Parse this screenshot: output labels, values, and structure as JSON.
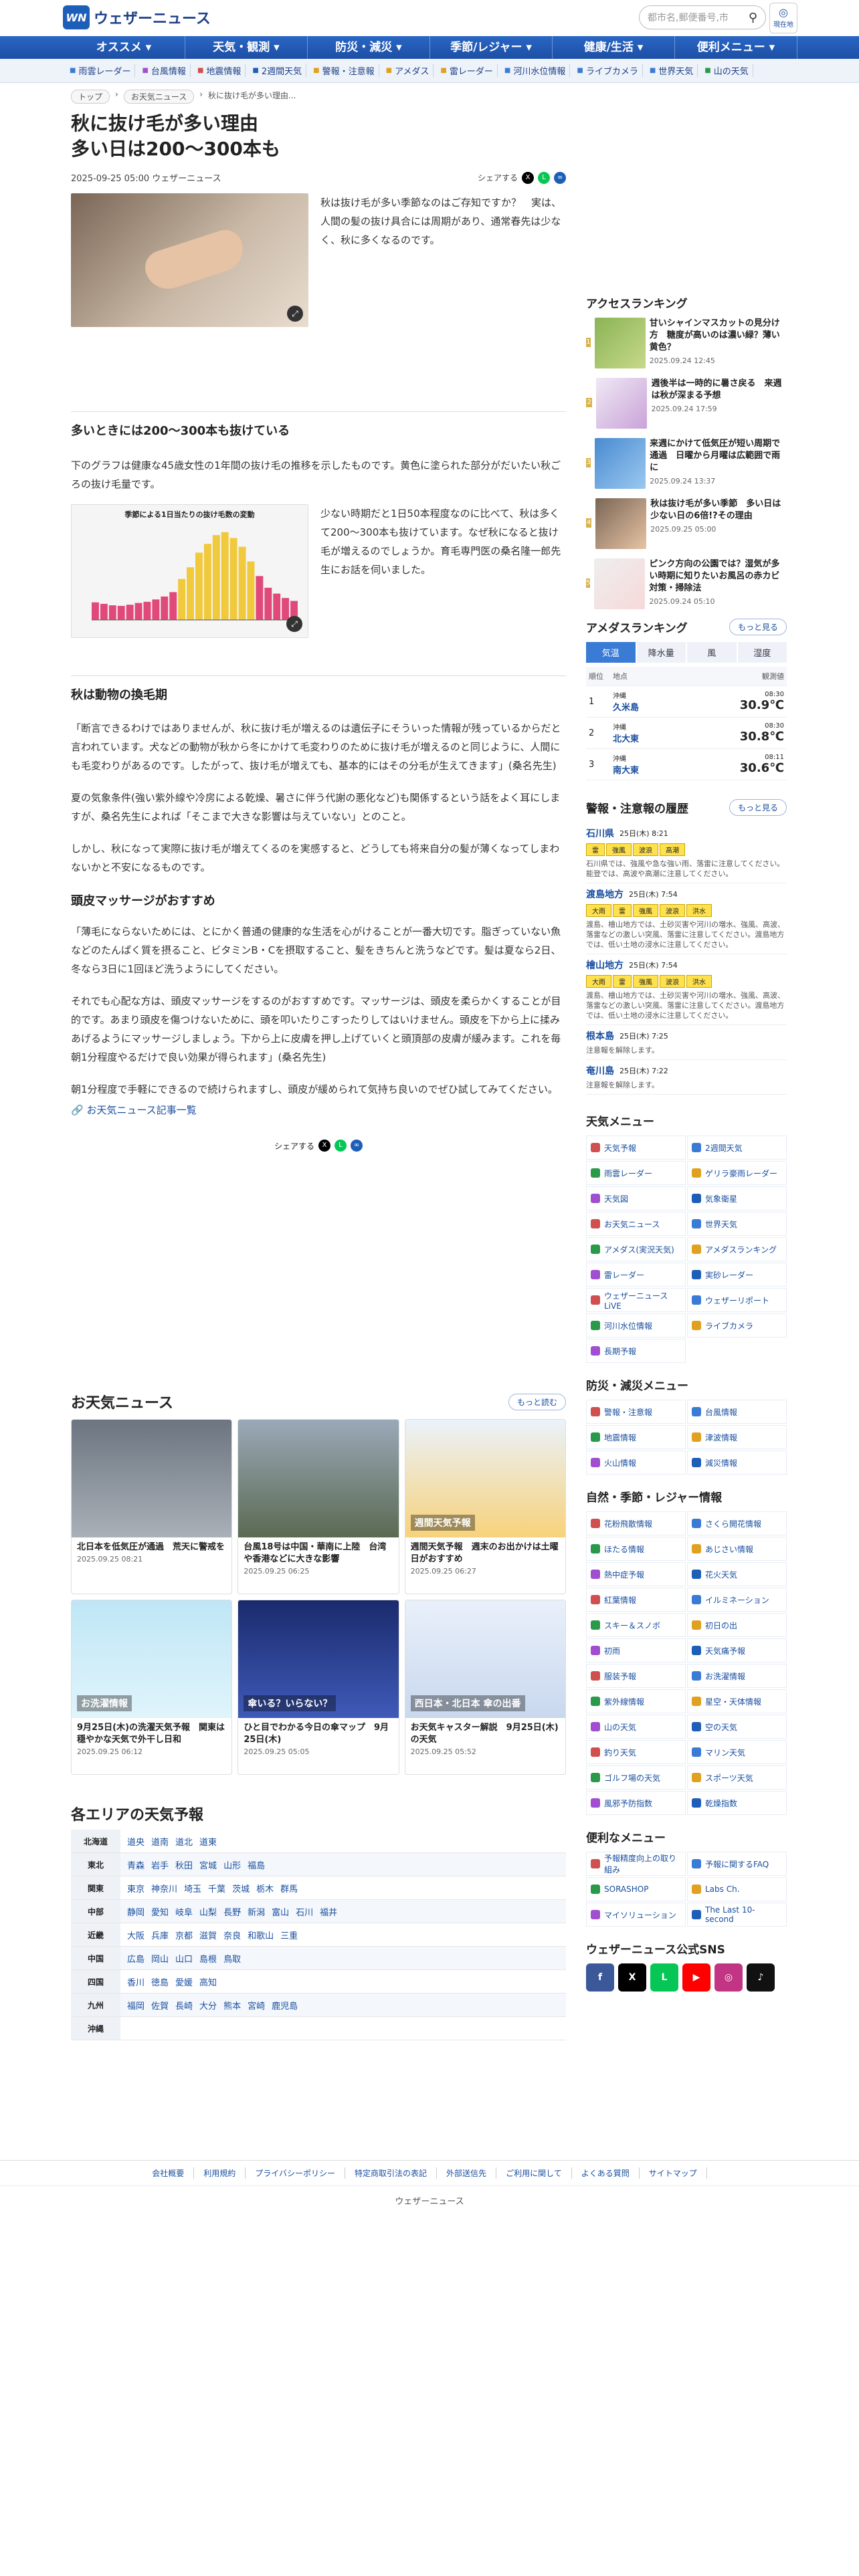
{
  "header": {
    "logo_mark": "WN",
    "logo_text": "ウェザーニュース",
    "search_placeholder": "都市名,郵便番号,市",
    "loc_label": "現在地"
  },
  "nav": [
    "オススメ",
    "天気・観測",
    "防災・減災",
    "季節/レジャー",
    "健康/生活",
    "便利メニュー"
  ],
  "subnav": [
    "雨雲レーダー",
    "台風情報",
    "地震情報",
    "2週間天気",
    "警報・注意報",
    "アメダス",
    "雷レーダー",
    "河川水位情報",
    "ライブカメラ",
    "世界天気",
    "山の天気"
  ],
  "breadcrumb": [
    "トップ",
    "お天気ニュース",
    "秋に抜け毛が多い理由..."
  ],
  "article": {
    "title_line1": "秋に抜け毛が多い理由",
    "title_line2": "多い日は200〜300本も",
    "date": "2025-09-25 05:00 ウェザーニュース",
    "share_label": "シェアする",
    "intro": "秋は抜け毛が多い季節なのはご存知ですか？　実は、人間の髪の抜け具合には周期があり、通常春先は少なく、秋に多くなるのです。",
    "h1": "多いときには200〜300本も抜けている",
    "p1": "下のグラフは健康な45歳女性の1年間の抜け毛の推移を示したものです。黄色に塗られた部分がだいたい秋ごろの抜け毛量です。",
    "chart_title": "季節による1日当たりの抜け毛数の変動",
    "p2": "少ない時期だと1日50本程度なのに比べて、秋は多くて200〜300本も抜けています。なぜ秋になると抜け毛が増えるのでしょうか。育毛専門医の桑名隆一郎先生にお話を伺いました。",
    "h2": "秋は動物の換毛期",
    "p3": "「断言できるわけではありませんが、秋に抜け毛が増えるのは遺伝子にそういった情報が残っているからだと言われています。犬などの動物が秋から冬にかけて毛変わりのために抜け毛が増えるのと同じように、人間にも毛変わりがあるのです。したがって、抜け毛が増えても、基本的にはその分毛が生えてきます」(桑名先生)",
    "p4": "夏の気象条件(強い紫外線や冷房による乾燥、暑さに伴う代謝の悪化など)も関係するという話をよく耳にしますが、桑名先生によれば「そこまで大きな影響は与えていない」とのこと。",
    "p5": "しかし、秋になって実際に抜け毛が増えてくるのを実感すると、どうしても将来自分の髪が薄くなってしまわないかと不安になるものです。",
    "h3": "頭皮マッサージがおすすめ",
    "p6": "「薄毛にならないためには、とにかく普通の健康的な生活を心がけることが一番大切です。脂ぎっていない魚などのたんぱく質を摂ること、ビタミンB・Cを摂取すること、髪をきちんと洗うなどです。髪は夏なら2日、冬なら3日に1回ほど洗うようにしてください。",
    "p7": "それでも心配な方は、頭皮マッサージをするのがおすすめです。マッサージは、頭皮を柔らかくすることが目的です。あまり頭皮を傷つけないために、頭を叩いたりこすったりしてはいけません。頭皮を下から上に揉みあげるようにマッサージしましょう。下から上に皮膚を押し上げていくと頭頂部の皮膚が緩みます。これを毎朝1分程度やるだけで良い効果が得られます」(桑名先生)",
    "p8": "朝1分程度で手軽にできるので続けられますし、頭皮が緩められて気持ち良いのでぜひ試してみてください。",
    "link": "お天気ニュース記事一覧"
  },
  "ranking": {
    "title": "アクセスランキング",
    "items": [
      {
        "title": "甘いシャインマスカットの見分け方　糖度が高いのは濃い緑？薄い黄色？",
        "date": "2025.09.24 12:45"
      },
      {
        "title": "週後半は一時的に暑さ戻る　来週は秋が深まる予想",
        "date": "2025.09.24 17:59"
      },
      {
        "title": "来週にかけて低気圧が短い周期で通過　日曜から月曜は広範囲で雨に",
        "date": "2025.09.24 13:37"
      },
      {
        "title": "秋は抜け毛が多い季節　多い日は少ない日の6倍!?その理由",
        "date": "2025.09.25 05:00"
      },
      {
        "title": "ピンク方向の公園では？湿気が多い時期に知りたいお風呂の赤カビ対策・掃除法",
        "date": "2025.09.24 05:10"
      }
    ]
  },
  "amedas": {
    "title": "アメダスランキング",
    "more": "もっと見る",
    "tabs": [
      "気温",
      "降水量",
      "風",
      "湿度"
    ],
    "headers": [
      "順位",
      "地点",
      "観測値"
    ],
    "rows": [
      {
        "rank": "1",
        "pref": "沖縄",
        "name": "久米島",
        "time": "08:30",
        "val": "30.9℃"
      },
      {
        "rank": "2",
        "pref": "沖縄",
        "name": "北大東",
        "time": "08:30",
        "val": "30.8℃"
      },
      {
        "rank": "3",
        "pref": "沖縄",
        "name": "南大東",
        "time": "08:11",
        "val": "30.6℃"
      }
    ]
  },
  "warnings": {
    "title": "警報・注意報の履歴",
    "more": "もっと見る",
    "items": [
      {
        "area": "石川県",
        "time": "25日(木) 8:21",
        "badges": [
          "雷",
          "強風",
          "波浪",
          "高潮"
        ],
        "text": "石川県では、強風や急な強い雨、落雷に注意してください。能登では、高波や高潮に注意してください。"
      },
      {
        "area": "渡島地方",
        "time": "25日(木) 7:54",
        "badges": [
          "大雨",
          "雷",
          "強風",
          "波浪",
          "洪水"
        ],
        "text": "渡島、檜山地方では、土砂災害や河川の増水、強風、高波、落雷などの激しい突風、落雷に注意してください。渡島地方では、低い土地の浸水に注意してください。"
      },
      {
        "area": "檜山地方",
        "time": "25日(木) 7:54",
        "badges": [
          "大雨",
          "雷",
          "強風",
          "波浪",
          "洪水"
        ],
        "text": "渡島、檜山地方では、土砂災害や河川の増水、強風、高波、落雷などの激しい突風、落雷に注意してください。渡島地方では、低い土地の浸水に注意してください。"
      },
      {
        "area": "根本島",
        "time": "25日(木) 7:25",
        "badges": [],
        "text": "注意報を解除します。"
      },
      {
        "area": "奄川島",
        "time": "25日(木) 7:22",
        "badges": [],
        "text": "注意報を解除します。"
      }
    ]
  },
  "weather_menu": {
    "title": "天気メニュー",
    "items": [
      "天気予報",
      "2週間天気",
      "雨雲レーダー",
      "ゲリラ豪雨レーダー",
      "天気図",
      "気象衛星",
      "お天気ニュース",
      "世界天気",
      "アメダス(実況天気)",
      "アメダスランキング",
      "雷レーダー",
      "実砂レーダー",
      "ウェザーニュースLiVE",
      "ウェザーリポート",
      "河川水位情報",
      "ライブカメラ",
      "長期予報"
    ]
  },
  "disaster_menu": {
    "title": "防災・減災メニュー",
    "items": [
      "警報・注意報",
      "台風情報",
      "地震情報",
      "津波情報",
      "火山情報",
      "減災情報"
    ]
  },
  "season_menu": {
    "title": "自然・季節・レジャー情報",
    "items": [
      "花粉飛散情報",
      "さくら開花情報",
      "ほたる情報",
      "あじさい情報",
      "熱中症予報",
      "花火天気",
      "紅葉情報",
      "イルミネーション",
      "スキー＆スノボ",
      "初日の出",
      "初雨",
      "天気痛予報",
      "服装予報",
      "お洗濯情報",
      "紫外線情報",
      "星空・天体情報",
      "山の天気",
      "空の天気",
      "釣り天気",
      "マリン天気",
      "ゴルフ場の天気",
      "スポーツ天気",
      "風邪予防指数",
      "乾燥指数"
    ]
  },
  "useful_menu": {
    "title": "便利なメニュー",
    "items": [
      "予報精度向上の取り組み",
      "予報に関するFAQ",
      "SORASHOP",
      "Labs Ch.",
      "マイソリューション",
      "The Last 10-second"
    ]
  },
  "sns": {
    "title": "ウェザーニュース公式SNS",
    "items": [
      "f",
      "X",
      "L",
      "▶",
      "◎",
      "♪"
    ],
    "colors": [
      "#3b5998",
      "#000000",
      "#06c755",
      "#ff0000",
      "#c13584",
      "#111111"
    ]
  },
  "news": {
    "title": "お天気ニュース",
    "more": "もっと読む",
    "items": [
      {
        "title": "北日本を低気圧が通過　荒天に警戒を",
        "date": "2025.09.25 08:21"
      },
      {
        "title": "台風18号は中国・華南に上陸　台湾や香港などに大きな影響",
        "date": "2025.09.25 06:25"
      },
      {
        "title": "週間天気予報　週末のお出かけは土曜日がおすすめ",
        "date": "2025.09.25 06:27"
      },
      {
        "title": "9月25日(木)の洗濯天気予報　関東は穏やかな天気で外干し日和",
        "date": "2025.09.25 06:12"
      },
      {
        "title": "ひと目でわかる今日の傘マップ　9月25日(木)",
        "date": "2025.09.25 05:05"
      },
      {
        "title": "お天気キャスター解説　9月25日(木)の天気",
        "date": "2025.09.25 05:52"
      }
    ],
    "img_texts": [
      "",
      "",
      "週間天気予報",
      "お洗濯情報",
      "傘いる？いらない？",
      "西日本・北日本 傘の出番"
    ]
  },
  "areas": {
    "title": "各エリアの天気予報",
    "rows": [
      {
        "name": "北海道",
        "links": [
          "道央",
          "道南",
          "道北",
          "道東"
        ]
      },
      {
        "name": "東北",
        "links": [
          "青森",
          "岩手",
          "秋田",
          "宮城",
          "山形",
          "福島"
        ]
      },
      {
        "name": "関東",
        "links": [
          "東京",
          "神奈川",
          "埼玉",
          "千葉",
          "茨城",
          "栃木",
          "群馬"
        ]
      },
      {
        "name": "中部",
        "links": [
          "静岡",
          "愛知",
          "岐阜",
          "山梨",
          "長野",
          "新潟",
          "富山",
          "石川",
          "福井"
        ]
      },
      {
        "name": "近畿",
        "links": [
          "大阪",
          "兵庫",
          "京都",
          "滋賀",
          "奈良",
          "和歌山",
          "三重"
        ]
      },
      {
        "name": "中国",
        "links": [
          "広島",
          "岡山",
          "山口",
          "島根",
          "鳥取"
        ]
      },
      {
        "name": "四国",
        "links": [
          "香川",
          "徳島",
          "愛媛",
          "高知"
        ]
      },
      {
        "name": "九州",
        "links": [
          "福岡",
          "佐賀",
          "長崎",
          "大分",
          "熊本",
          "宮崎",
          "鹿児島"
        ]
      },
      {
        "name": "沖縄",
        "links": []
      }
    ]
  },
  "footer": {
    "links": [
      "会社概要",
      "利用規約",
      "プライバシーポリシー",
      "特定商取引法の表記",
      "外部送信先",
      "ご利用に関して",
      "よくある質問",
      "サイトマップ"
    ],
    "copyright": "ウェザーニュース"
  }
}
